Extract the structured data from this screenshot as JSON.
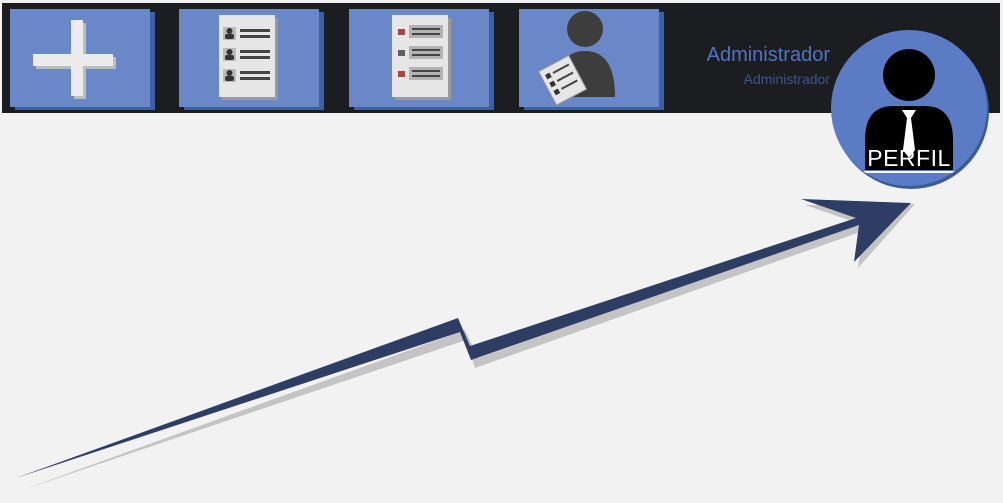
{
  "toolbar": {
    "tiles": [
      {
        "name": "add",
        "icon": "plus-icon"
      },
      {
        "name": "user-list",
        "icon": "user-list-icon"
      },
      {
        "name": "task-list",
        "icon": "folder-list-icon"
      },
      {
        "name": "user-document",
        "icon": "user-document-icon"
      }
    ]
  },
  "user": {
    "name": "Administrador",
    "role": "Administrador"
  },
  "profile": {
    "label": "PERFIL",
    "icon": "businessman-icon"
  },
  "colors": {
    "topbar": "#1c1d20",
    "tile": "#6a88c8",
    "tile_shadow": "#3d5fa8",
    "accent_text": "#4f75c2",
    "arrow": "#2e3d63",
    "page": "#f2f2f2"
  }
}
